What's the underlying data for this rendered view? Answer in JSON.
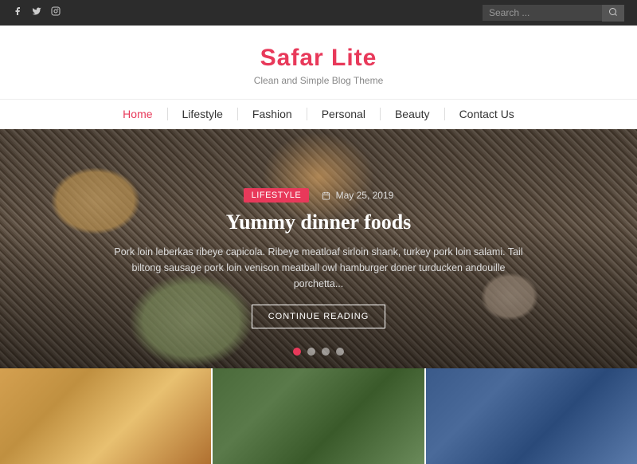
{
  "topbar": {
    "social": [
      {
        "name": "facebook",
        "symbol": "f"
      },
      {
        "name": "twitter",
        "symbol": "t"
      },
      {
        "name": "instagram",
        "symbol": "i"
      }
    ],
    "search_placeholder": "Search ..."
  },
  "header": {
    "title": "Safar Lite",
    "tagline": "Clean and Simple Blog Theme"
  },
  "nav": {
    "items": [
      {
        "label": "Home",
        "active": true
      },
      {
        "label": "Lifestyle",
        "active": false
      },
      {
        "label": "Fashion",
        "active": false
      },
      {
        "label": "Personal",
        "active": false
      },
      {
        "label": "Beauty",
        "active": false
      },
      {
        "label": "Contact Us",
        "active": false
      }
    ]
  },
  "hero": {
    "tag": "LIFESTYLE",
    "date": "May 25, 2019",
    "title": "Yummy dinner foods",
    "excerpt": "Pork loin leberkas ribeye capicola. Ribeye meatloaf sirloin shank, turkey pork loin salami. Tail biltong sausage pork loin venison meatball owl hamburger doner turducken andouille porchetta...",
    "button_label": "CONTINUE READING",
    "dots": [
      {
        "active": true
      },
      {
        "active": false
      },
      {
        "active": false
      },
      {
        "active": false
      }
    ]
  },
  "thumbnails": [
    {
      "alt": "thumbnail 1"
    },
    {
      "alt": "thumbnail 2"
    },
    {
      "alt": "thumbnail 3"
    }
  ]
}
